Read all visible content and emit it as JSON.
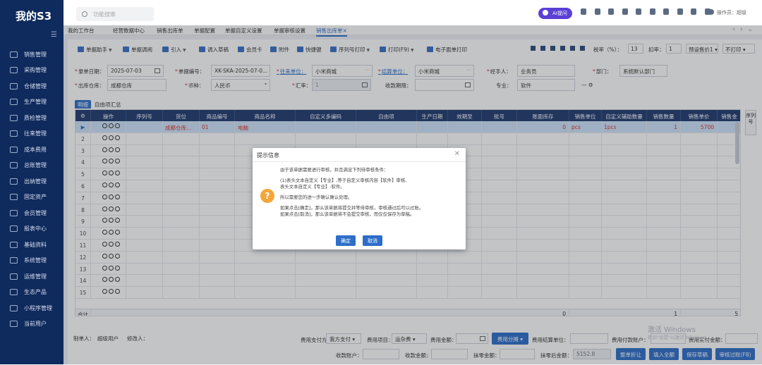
{
  "app": {
    "brand": "我的S3"
  },
  "sidebar": {
    "items": [
      {
        "label": "销售管理"
      },
      {
        "label": "采购管理"
      },
      {
        "label": "仓储管理"
      },
      {
        "label": "生产管理"
      },
      {
        "label": "质检管理"
      },
      {
        "label": "往来管理"
      },
      {
        "label": "成本费用"
      },
      {
        "label": "总账管理"
      },
      {
        "label": "出纳管理"
      },
      {
        "label": "固定资产"
      },
      {
        "label": "会员管理"
      },
      {
        "label": "报表中心"
      },
      {
        "label": "基础资料"
      },
      {
        "label": "系统管理"
      },
      {
        "label": "运维管理"
      },
      {
        "label": "生态产品"
      },
      {
        "label": "小程序管理"
      },
      {
        "label": "当前用户"
      }
    ]
  },
  "topbar": {
    "search_placeholder": "功能搜索",
    "ai_label": "AI提问",
    "user_label": "操作员：超级"
  },
  "tabs": [
    {
      "label": "我的工作台"
    },
    {
      "label": "经营数据中心"
    },
    {
      "label": "销售出库单"
    },
    {
      "label": "单据配置"
    },
    {
      "label": "单据自定义设置"
    },
    {
      "label": "单据审核设置"
    },
    {
      "label": "销售出库单×"
    }
  ],
  "toolbar": {
    "items": [
      {
        "label": "单据助手"
      },
      {
        "label": "单据调阅"
      },
      {
        "label": "引入"
      },
      {
        "label": "调入草稿"
      },
      {
        "label": "会员卡"
      },
      {
        "label": "附件"
      },
      {
        "label": "快捷键"
      },
      {
        "label": "序列号打印"
      },
      {
        "label": "打印(F9)"
      },
      {
        "label": "电子面单打印"
      }
    ],
    "tax_rate_label": "税率（%）：",
    "tax_rate_value": "13",
    "discount_label": "扣率：",
    "discount_value": "1",
    "price_select": "预设售价1",
    "print_select": "不打印"
  },
  "form": {
    "date_label": "录单日期：",
    "date_value": "2025-07-03",
    "doc_no_label": "单据编号：",
    "doc_no_value": "XK-SKA-2025-07-0...",
    "partner_label": "往来单位：",
    "partner_value": "小米商城",
    "settle_label": "结算单位：",
    "settle_value": "小米商城",
    "handler_label": "经手人：",
    "handler_value": "业务员",
    "dept_label": "部门：",
    "dept_value": "系统默认部门",
    "warehouse_label": "出库仓库：",
    "warehouse_value": "成都仓库",
    "currency_label": "币种：",
    "currency_value": "人民币",
    "exchange_label": "汇率：",
    "exchange_value": "1",
    "due_label": "收款期限：",
    "major_label": "专业：",
    "major_value": "软件"
  },
  "subtabs": [
    {
      "label": "明细"
    },
    {
      "label": "自由项汇总"
    }
  ],
  "grid": {
    "headers": [
      "操作",
      "序列号",
      "货位",
      "商品编号",
      "商品名称",
      "自定义多编码",
      "自由项",
      "生产日期",
      "效期至",
      "批号",
      "账面库存",
      "销售单位",
      "自定义辅助数量",
      "销售数量",
      "销售单价",
      "销售金"
    ],
    "row1": {
      "location": "成都仓库...",
      "code": "01",
      "name": "电脑",
      "stock": "0",
      "unit": "pcs",
      "aux_qty": "1pcs",
      "qty": "1",
      "price": "5700"
    },
    "row_numbers": [
      "2",
      "3",
      "4",
      "5",
      "6",
      "7",
      "8",
      "9",
      "10",
      "11",
      "12",
      "13",
      "14",
      "15"
    ],
    "total_label": "合计",
    "total_stock": "0",
    "total_qty": "1",
    "total_amount": "5"
  },
  "side_tab": {
    "label": "序列号"
  },
  "footer": {
    "creator_label": "制单人：",
    "creator_value": "超级用户",
    "modifier_label": "修改人：",
    "pay_method_label": "费用支付方式：",
    "pay_method_value": "我方支付",
    "fee_item_label": "费用项目：",
    "fee_item_value": "运杂费",
    "fee_amount_label": "费用金额：",
    "fee_split_label": "费用分摊",
    "fee_unit_label": "费用结算单位：",
    "fee_account_label": "费用付款账户：",
    "fee_paid_label": "费用实付金额：",
    "receive_account_label": "收款账户：",
    "receive_amount_label": "收款金额：",
    "wipe_amount_label": "抹零金额：",
    "after_wipe_label": "抹零后金额：",
    "after_wipe_value": "5152.8",
    "btn_discount": "整单折让",
    "btn_fill_all": "填入全额",
    "btn_save_draft": "保存草稿",
    "btn_audit": "审核过账(F8)"
  },
  "watermark": {
    "title": "激活 Windows",
    "sub": "转到\"设置\"以激活 Windows。"
  },
  "dialog": {
    "title": "提示信息",
    "line1": "由于该单据需要进行审核，并且满足下列待审核条件：",
    "line2": "(1)表头文本自定义【专业】,等于自定义审核内容【软件】审核,",
    "line3": "表头文本自定义【专业】:软件。",
    "line4": "所以需要您的进一步确认确认处理。",
    "line5": "如果点击[确定]，那么该单据将提交并等待审核，审核通过后可以过账。",
    "line6": "如果点击[取消]，那么该单据将不会提交审核，而仅仅保存为草稿。",
    "ok_label": "确定",
    "cancel_label": "取消"
  }
}
